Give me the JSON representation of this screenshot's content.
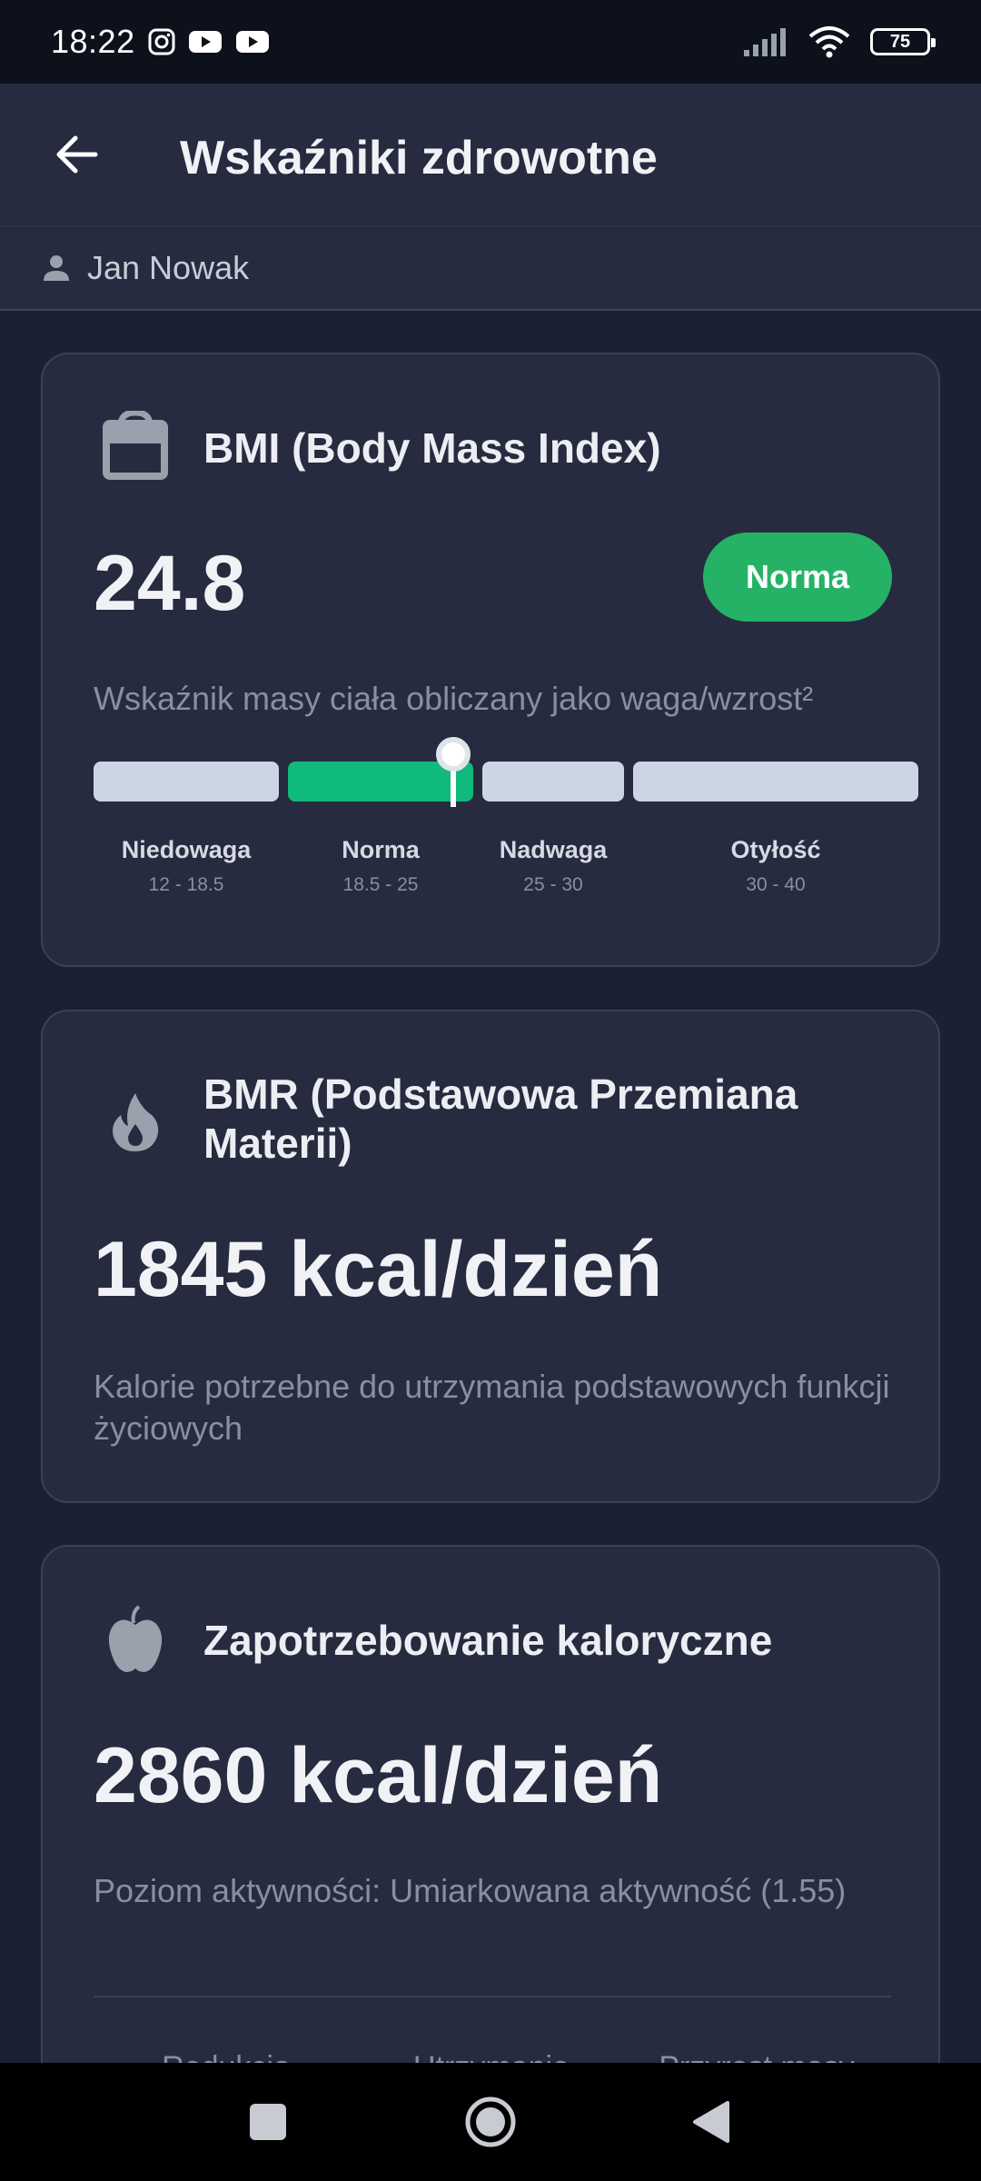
{
  "status_bar": {
    "time": "18:22",
    "battery_level": "75",
    "app_icons": [
      "instagram-icon",
      "youtube-icon",
      "youtube-icon"
    ]
  },
  "header": {
    "title": "Wskaźniki zdrowotne",
    "back_icon": "arrow-left-icon"
  },
  "user": {
    "name": "Jan Nowak",
    "icon": "person-icon"
  },
  "bmi_card": {
    "icon": "scale-icon",
    "title": "BMI (Body Mass Index)",
    "value": "24.8",
    "status": "Norma",
    "description": "Wskaźnik masy ciała obliczany jako waga/wzrost²",
    "indicator_value": 24.8,
    "ranges": [
      {
        "label": "Niedowaga",
        "range": "12 - 18.5",
        "min": 12,
        "max": 18.5
      },
      {
        "label": "Norma",
        "range": "18.5 - 25",
        "min": 18.5,
        "max": 25
      },
      {
        "label": "Nadwaga",
        "range": "25 - 30",
        "min": 25,
        "max": 30
      },
      {
        "label": "Otyłość",
        "range": "30 - 40",
        "min": 30,
        "max": 40
      }
    ],
    "active_range": 1
  },
  "bmr_card": {
    "icon": "flame-icon",
    "title": "BMR (Podstawowa Przemiana Materii)",
    "value": "1845 kcal/dzień",
    "description": "Kalorie potrzebne do utrzymania podstawowych funkcji życiowych"
  },
  "calorie_card": {
    "icon": "apple-icon",
    "title": "Zapotrzebowanie kaloryczne",
    "value": "2860 kcal/dzień",
    "description": "Poziom aktywności: Umiarkowana aktywność (1.55)",
    "goals": [
      "Redukcja",
      "Utrzymanie",
      "Przyrost masy"
    ]
  },
  "colors": {
    "background": "#1b2032",
    "card": "#262b3f",
    "accent_green": "#26b266",
    "bar_active": "#10b97c",
    "bar_inactive": "#ccd5e3"
  },
  "nav": {
    "recents_icon": "square-icon",
    "home_icon": "circle-home-icon",
    "back_icon": "triangle-back-icon"
  }
}
